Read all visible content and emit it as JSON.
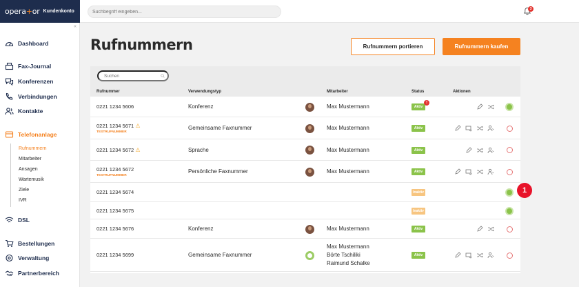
{
  "brand": {
    "logo_pre": "opera",
    "logo_plus": "+",
    "logo_post": "or",
    "sub": "Kundenkonto"
  },
  "topbar": {
    "search_placeholder": "Suchbegriff eingeben...",
    "notification_count": "3"
  },
  "sidebar": {
    "collapse_icon": "«",
    "items": [
      {
        "label": "Dashboard",
        "icon": "speedometer-icon"
      },
      {
        "label": "Fax-Journal",
        "icon": "fax-icon"
      },
      {
        "label": "Konferenzen",
        "icon": "chat-icon"
      },
      {
        "label": "Verbindungen",
        "icon": "phone-icon"
      },
      {
        "label": "Kontakte",
        "icon": "contacts-icon"
      },
      {
        "label": "Telefonanlage",
        "icon": "pbx-icon"
      },
      {
        "label": "DSL",
        "icon": "wifi-icon"
      },
      {
        "label": "Bestellungen",
        "icon": "cart-icon"
      },
      {
        "label": "Verwaltung",
        "icon": "gear-icon"
      },
      {
        "label": "Partnerbereich",
        "icon": "handshake-icon"
      }
    ],
    "subitems": [
      "Rufnummern",
      "Mitarbeiter",
      "Ansagen",
      "Wartemusik",
      "Ziele",
      "IVR"
    ]
  },
  "page": {
    "title": "Rufnummern",
    "btn_port": "Rufnummern portieren",
    "btn_buy": "Rufnummern kaufen"
  },
  "table": {
    "search_placeholder": "Suchen",
    "headers": {
      "number": "Rufnummer",
      "type": "Verwendungstyp",
      "employee": "Mitarbeiter",
      "status": "Status",
      "actions": "Aktionen"
    },
    "rows": [
      {
        "number": "0221 1234 5606",
        "warn": "",
        "tag": "",
        "type": "Konferenz",
        "people": [
          "Max Mustermann"
        ],
        "status": "Aktiv",
        "status_alert": "!",
        "power": "on"
      },
      {
        "number": "0221 1234 5671",
        "warn": "⚠",
        "tag": "TESTRUFNUMMER",
        "type": "Gemeinsame Faxnummer",
        "people": [
          "Max Mustermann"
        ],
        "status": "Aktiv",
        "status_alert": "",
        "power": "off"
      },
      {
        "number": "0221 1234 5672",
        "warn": "⚠",
        "tag": "",
        "type": "Sprache",
        "people": [
          "Max Mustermann"
        ],
        "status": "Aktiv",
        "status_alert": "",
        "power": "off"
      },
      {
        "number": "0221 1234 5672",
        "warn": "",
        "tag": "TESTRUFNUMMER",
        "type": "Persönliche Faxnummer",
        "people": [
          "Max Mustermann"
        ],
        "status": "Aktiv",
        "status_alert": "",
        "power": "off"
      },
      {
        "number": "0221 1234 5674",
        "warn": "",
        "tag": "",
        "type": "",
        "people": [],
        "status": "Inaktiv",
        "status_alert": "",
        "power": "on"
      },
      {
        "number": "0221 1234 5675",
        "warn": "",
        "tag": "",
        "type": "",
        "people": [],
        "status": "Inaktiv",
        "status_alert": "",
        "power": "on"
      },
      {
        "number": "0221 1234 5676",
        "warn": "",
        "tag": "",
        "type": "Konferenz",
        "people": [
          "Max Mustermann"
        ],
        "status": "Aktiv",
        "status_alert": "",
        "power": "off"
      },
      {
        "number": "0221 1234 5699",
        "warn": "",
        "tag": "",
        "type": "Gemeinsame Faxnummer",
        "people": [
          "Max Mustermann",
          "Börte Tschiliki",
          "Raimund Schalke"
        ],
        "status": "Aktiv",
        "status_alert": "",
        "power": "off"
      }
    ]
  },
  "marker": "1",
  "colors": {
    "accent": "#f58220",
    "brand": "#1e2d4d",
    "active": "#8bc34a",
    "inactive": "#f7c580",
    "alert": "#e3342f"
  }
}
